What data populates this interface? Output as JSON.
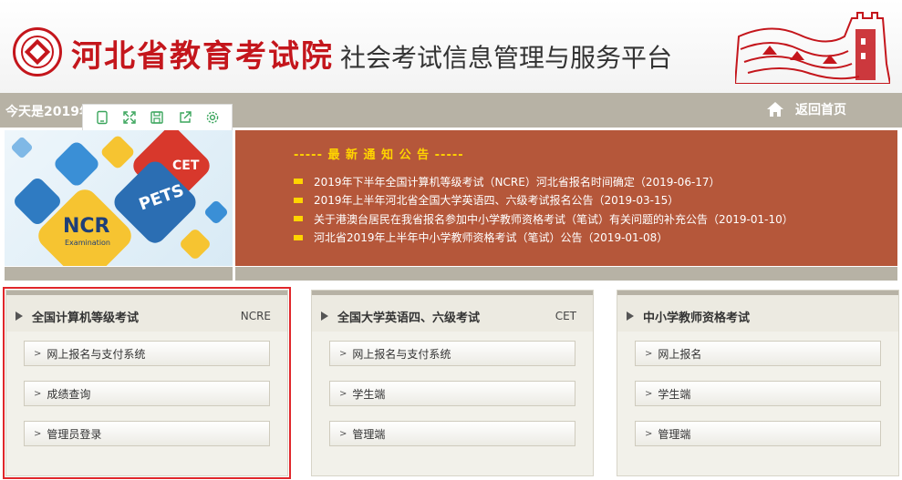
{
  "header": {
    "org_name": "河北省教育考试院",
    "platform_name": "社会考试信息管理与服务平台"
  },
  "bar": {
    "today_text": "今天是2019年",
    "home_label": "返回首页"
  },
  "toolbar": {
    "icons": [
      "tablet-icon",
      "fullscreen-icon",
      "save-icon",
      "share-icon",
      "settings-icon"
    ]
  },
  "banner": {
    "cet_text": "CET",
    "ncre_text": "NCR",
    "exam_text": "Examination",
    "pets_text": "PETS"
  },
  "notice": {
    "title": "----- 最 新 通 知 公 告 -----",
    "items": [
      "2019年下半年全国计算机等级考试（NCRE）河北省报名时间确定（2019-06-17）",
      "2019年上半年河北省全国大学英语四、六级考试报名公告（2019-03-15）",
      "关于港澳台居民在我省报名参加中小学教师资格考试（笔试）有关问题的补充公告（2019-01-10）",
      "河北省2019年上半年中小学教师资格考试（笔试）公告（2019-01-08）"
    ]
  },
  "panels": [
    {
      "title": "全国计算机等级考试",
      "code": "NCRE",
      "buttons": [
        "网上报名与支付系统",
        "成绩查询",
        "管理员登录"
      ]
    },
    {
      "title": "全国大学英语四、六级考试",
      "code": "CET",
      "buttons": [
        "网上报名与支付系统",
        "学生端",
        "管理端"
      ]
    },
    {
      "title": "中小学教师资格考试",
      "code": "",
      "buttons": [
        "网上报名",
        "学生端",
        "管理端"
      ]
    }
  ],
  "colors": {
    "brand_red": "#c4161c",
    "notice_bg": "#b5573a",
    "notice_title": "#ffd400",
    "bar_grey": "#b7b2a5",
    "selection_outline": "#e0262a"
  }
}
